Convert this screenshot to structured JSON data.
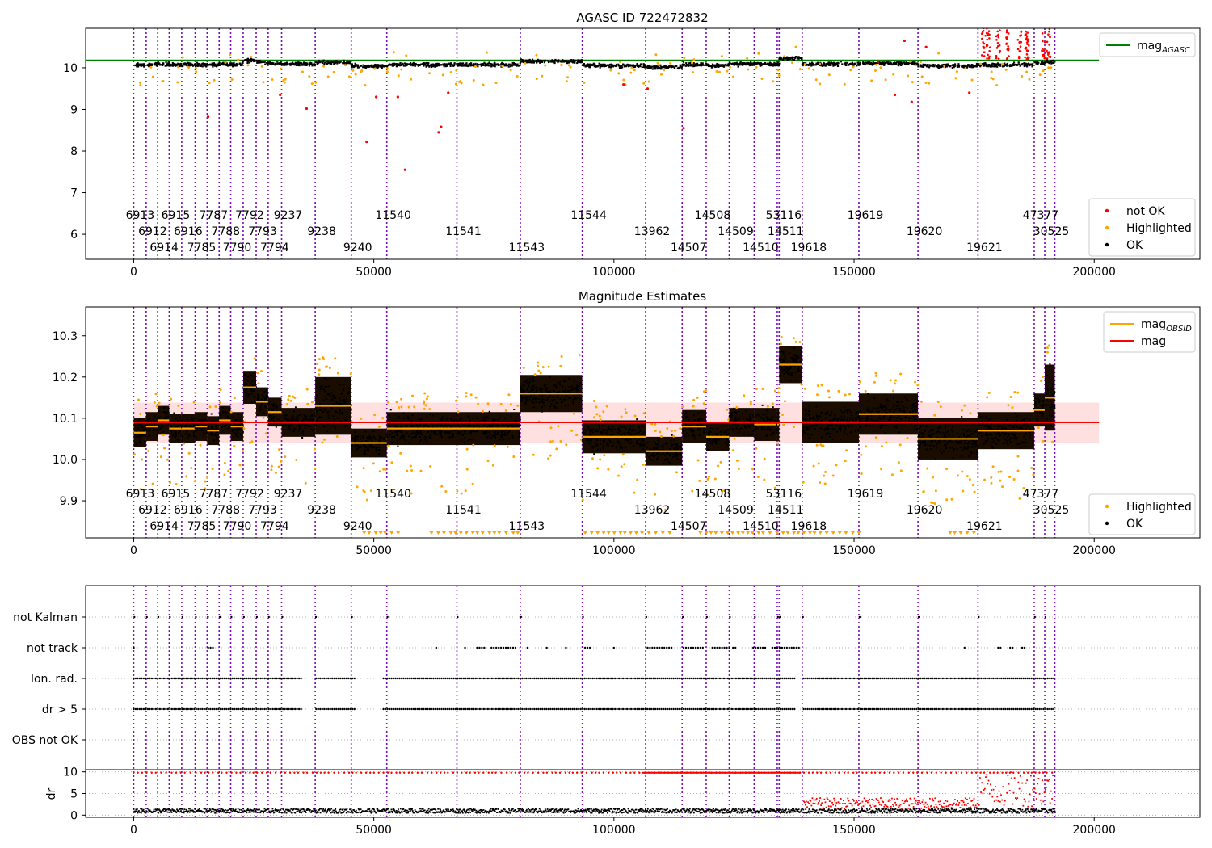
{
  "chart_data": [
    {
      "type": "scatter",
      "title": "AGASC ID 722472832",
      "xlim": [
        -10000,
        222000
      ],
      "ylim": [
        5.4,
        10.95
      ],
      "x_ticks": [
        {
          "v": 0,
          "label": "0"
        },
        {
          "v": 50000,
          "label": "50000"
        },
        {
          "v": 100000,
          "label": "100000"
        },
        {
          "v": 150000,
          "label": "150000"
        },
        {
          "v": 200000,
          "label": "200000"
        }
      ],
      "y_ticks": [
        {
          "v": 6,
          "label": "6"
        },
        {
          "v": 7,
          "label": "7"
        },
        {
          "v": 8,
          "label": "8"
        },
        {
          "v": 9,
          "label": "9"
        },
        {
          "v": 10,
          "label": "10"
        }
      ],
      "mag_agasc": 10.18,
      "legend_upper": {
        "position": "top-right",
        "entries": [
          {
            "name": "mag",
            "sub": "AGASC",
            "color": "#008000"
          }
        ]
      },
      "legend_lower": {
        "position": "bottom-right",
        "entries": [
          {
            "name": "not OK",
            "color": "#ff0000"
          },
          {
            "name": "Highlighted",
            "color": "#ffa500"
          },
          {
            "name": "OK",
            "color": "#000000"
          }
        ]
      },
      "red_outliers": [
        [
          15500,
          8.82
        ],
        [
          30500,
          9.35
        ],
        [
          36000,
          9.02
        ],
        [
          48500,
          8.22
        ],
        [
          50500,
          9.3
        ],
        [
          55000,
          9.3
        ],
        [
          56500,
          7.55
        ],
        [
          63500,
          8.45
        ],
        [
          64000,
          8.58
        ],
        [
          65500,
          9.4
        ],
        [
          102000,
          9.6
        ],
        [
          107000,
          9.5
        ],
        [
          114500,
          8.55
        ],
        [
          155000,
          10.15
        ],
        [
          158500,
          9.35
        ],
        [
          160500,
          10.65
        ],
        [
          162000,
          9.18
        ],
        [
          165000,
          10.5
        ],
        [
          174000,
          9.4
        ]
      ]
    },
    {
      "type": "scatter",
      "title": "Magnitude Estimates",
      "xlim": [
        -10000,
        222000
      ],
      "ylim": [
        9.81,
        10.37
      ],
      "x_ticks": [
        {
          "v": 0,
          "label": "0"
        },
        {
          "v": 50000,
          "label": "50000"
        },
        {
          "v": 100000,
          "label": "100000"
        },
        {
          "v": 150000,
          "label": "150000"
        },
        {
          "v": 200000,
          "label": "200000"
        }
      ],
      "y_ticks": [
        {
          "v": 9.9,
          "label": "9.9"
        },
        {
          "v": 10.0,
          "label": "10.0"
        },
        {
          "v": 10.1,
          "label": "10.1"
        },
        {
          "v": 10.2,
          "label": "10.2"
        },
        {
          "v": 10.3,
          "label": "10.3"
        }
      ],
      "mag": 10.09,
      "mag_band": [
        10.04,
        10.138
      ],
      "legend_upper": {
        "position": "top-right",
        "entries": [
          {
            "name": "mag",
            "sub": "OBSID",
            "color": "#ffa500"
          },
          {
            "name": "mag",
            "color": "#ff0000"
          }
        ]
      },
      "legend_lower": {
        "position": "bottom-right",
        "entries": [
          {
            "name": "Highlighted",
            "color": "#ffa500"
          },
          {
            "name": "OK",
            "color": "#000000"
          }
        ]
      }
    },
    {
      "type": "scatter",
      "xlim": [
        -10000,
        222000
      ],
      "flag_rows": [
        "not Kalman",
        "not track",
        "Ion. rad.",
        "dr > 5",
        "OBS not OK"
      ],
      "dr_ylabel": "dr",
      "dr_ylim": [
        -0.5,
        10.5
      ],
      "dr_ticks": [
        {
          "v": 0,
          "label": "0"
        },
        {
          "v": 5,
          "label": "5"
        },
        {
          "v": 10,
          "label": "10"
        }
      ],
      "x_ticks": [
        {
          "v": 0,
          "label": "0"
        },
        {
          "v": 50000,
          "label": "50000"
        },
        {
          "v": 100000,
          "label": "100000"
        },
        {
          "v": 150000,
          "label": "150000"
        },
        {
          "v": 200000,
          "label": "200000"
        }
      ]
    }
  ],
  "obsids": [
    {
      "id": "6913",
      "start": 0,
      "end": 2600,
      "mag": 10.065,
      "spread": 0.035
    },
    {
      "id": "6912",
      "start": 2600,
      "end": 5000,
      "mag": 10.08,
      "spread": 0.035
    },
    {
      "id": "6914",
      "start": 5000,
      "end": 7400,
      "mag": 10.095,
      "spread": 0.035
    },
    {
      "id": "6915",
      "start": 7400,
      "end": 10000,
      "mag": 10.075,
      "spread": 0.035
    },
    {
      "id": "6916",
      "start": 10000,
      "end": 12800,
      "mag": 10.075,
      "spread": 0.035
    },
    {
      "id": "7785",
      "start": 12800,
      "end": 15300,
      "mag": 10.08,
      "spread": 0.035
    },
    {
      "id": "7787",
      "start": 15300,
      "end": 17800,
      "mag": 10.07,
      "spread": 0.035
    },
    {
      "id": "7788",
      "start": 17800,
      "end": 20200,
      "mag": 10.095,
      "spread": 0.035
    },
    {
      "id": "7790",
      "start": 20200,
      "end": 22800,
      "mag": 10.08,
      "spread": 0.035
    },
    {
      "id": "7792",
      "start": 22800,
      "end": 25500,
      "mag": 10.175,
      "spread": 0.04
    },
    {
      "id": "7793",
      "start": 25500,
      "end": 28000,
      "mag": 10.14,
      "spread": 0.035
    },
    {
      "id": "7794",
      "start": 28000,
      "end": 30800,
      "mag": 10.115,
      "spread": 0.035
    },
    {
      "id": "9237",
      "start": 30800,
      "end": 37800,
      "mag": 10.09,
      "spread": 0.035
    },
    {
      "id": "9238",
      "start": 37800,
      "end": 45300,
      "mag": 10.13,
      "spread": 0.07
    },
    {
      "id": "9240",
      "start": 45300,
      "end": 52700,
      "mag": 10.04,
      "spread": 0.035
    },
    {
      "id": "11540",
      "start": 52700,
      "end": 67300,
      "mag": 10.075,
      "spread": 0.04
    },
    {
      "id": "11541",
      "start": 67300,
      "end": 80500,
      "mag": 10.075,
      "spread": 0.04
    },
    {
      "id": "11543",
      "start": 80500,
      "end": 93400,
      "mag": 10.16,
      "spread": 0.045
    },
    {
      "id": "11544",
      "start": 93400,
      "end": 106600,
      "mag": 10.055,
      "spread": 0.04
    },
    {
      "id": "13962",
      "start": 106600,
      "end": 114200,
      "mag": 10.02,
      "spread": 0.035
    },
    {
      "id": "14507",
      "start": 114200,
      "end": 119200,
      "mag": 10.08,
      "spread": 0.04
    },
    {
      "id": "14508",
      "start": 119200,
      "end": 124000,
      "mag": 10.055,
      "spread": 0.035
    },
    {
      "id": "14509",
      "start": 124000,
      "end": 129200,
      "mag": 10.09,
      "spread": 0.035
    },
    {
      "id": "14510",
      "start": 129200,
      "end": 134000,
      "mag": 10.085,
      "spread": 0.04
    },
    {
      "id": "53116",
      "start": 134000,
      "end": 134400,
      "mag": 10.085,
      "spread": 0.04
    },
    {
      "id": "14511",
      "start": 134400,
      "end": 139200,
      "mag": 10.23,
      "spread": 0.045
    },
    {
      "id": "19618",
      "start": 139200,
      "end": 151000,
      "mag": 10.09,
      "spread": 0.05
    },
    {
      "id": "19619",
      "start": 151000,
      "end": 163300,
      "mag": 10.11,
      "spread": 0.05
    },
    {
      "id": "19620",
      "start": 163300,
      "end": 175800,
      "mag": 10.05,
      "spread": 0.05
    },
    {
      "id": "19621",
      "start": 175800,
      "end": 187500,
      "mag": 10.07,
      "spread": 0.045
    },
    {
      "id": "47377",
      "start": 187500,
      "end": 189700,
      "mag": 10.12,
      "spread": 0.04
    },
    {
      "id": "30525",
      "start": 189700,
      "end": 191800,
      "mag": 10.15,
      "spread": 0.08
    }
  ]
}
